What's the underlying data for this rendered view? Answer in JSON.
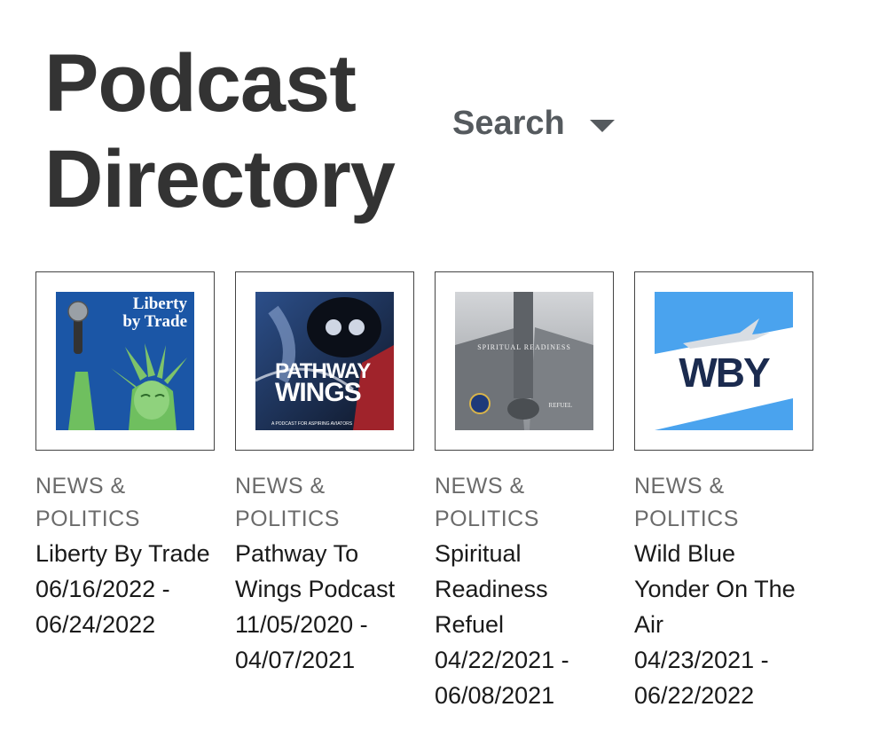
{
  "header": {
    "title_line1": "Podcast",
    "title_line2": "Directory",
    "search_label": "Search",
    "search_icon": "chevron-down-icon"
  },
  "podcasts": [
    {
      "category_line1": "NEWS &",
      "category_line2": "POLITICS",
      "name": "Liberty By Trade",
      "dates": "06/16/2022 - 06/24/2022",
      "art_text_line1": "Liberty",
      "art_text_line2": "by Trade"
    },
    {
      "category_line1": "NEWS &",
      "category_line2": "POLITICS",
      "name": "Pathway To Wings Podcast",
      "dates": "11/05/2020 - 04/07/2021",
      "art_text_line1": "PATHWAY",
      "art_text_line2": "WINGS",
      "art_text_line3": "A PODCAST FOR ASPIRING AVIATORS"
    },
    {
      "category_line1": "NEWS &",
      "category_line2": "POLITICS",
      "name": "Spiritual Readiness Refuel",
      "dates": "04/22/2021 - 06/08/2021",
      "art_text_line1": "SPIRITUAL READINESS",
      "art_text_line2": "REFUEL"
    },
    {
      "category_line1": "NEWS &",
      "category_line2": "POLITICS",
      "name": "Wild Blue Yonder On The Air",
      "dates": "04/23/2021 - 06/22/2022",
      "art_text_line1": "WBY"
    }
  ]
}
